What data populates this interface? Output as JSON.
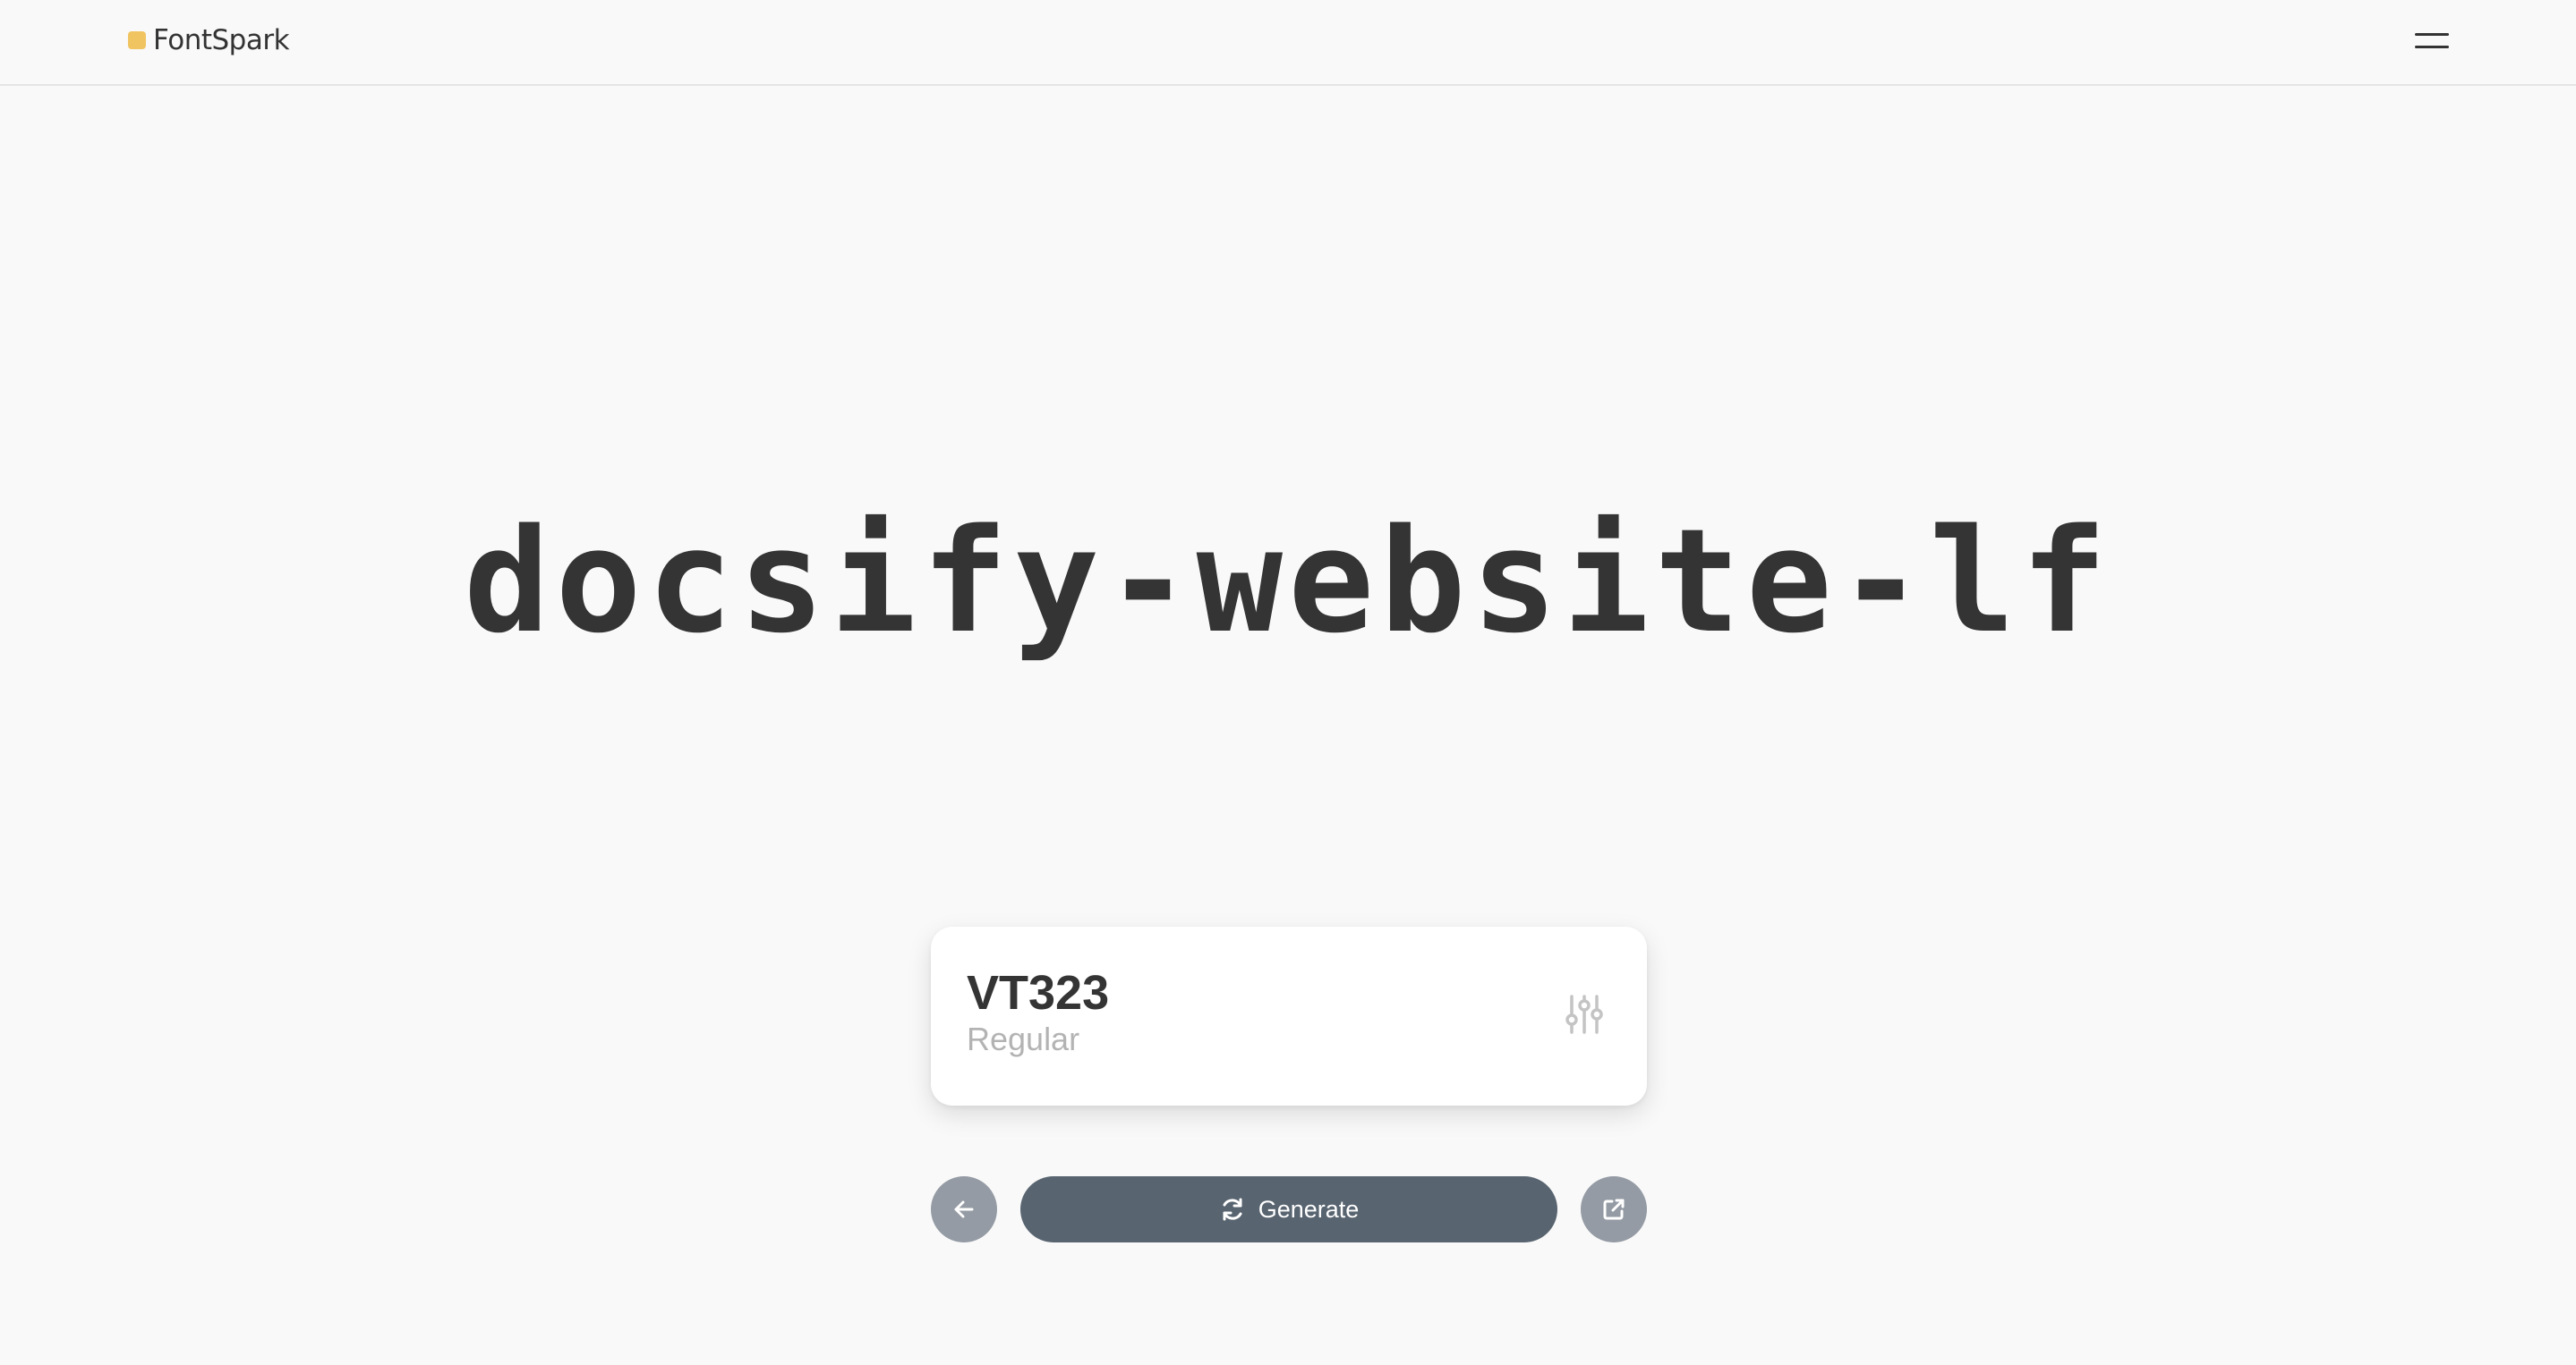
{
  "header": {
    "brand": "FontSpark",
    "brand_color": "#f1c462",
    "menu_icon": "hamburger-menu-icon"
  },
  "preview": {
    "text": "docsify-website-lf"
  },
  "font_card": {
    "name": "VT323",
    "style": "Regular",
    "settings_icon": "sliders-icon"
  },
  "controls": {
    "back_icon": "arrow-left-icon",
    "generate_label": "Generate",
    "generate_icon": "refresh-icon",
    "share_icon": "external-link-icon",
    "primary_color": "#586470",
    "secondary_color": "#949ba4"
  }
}
